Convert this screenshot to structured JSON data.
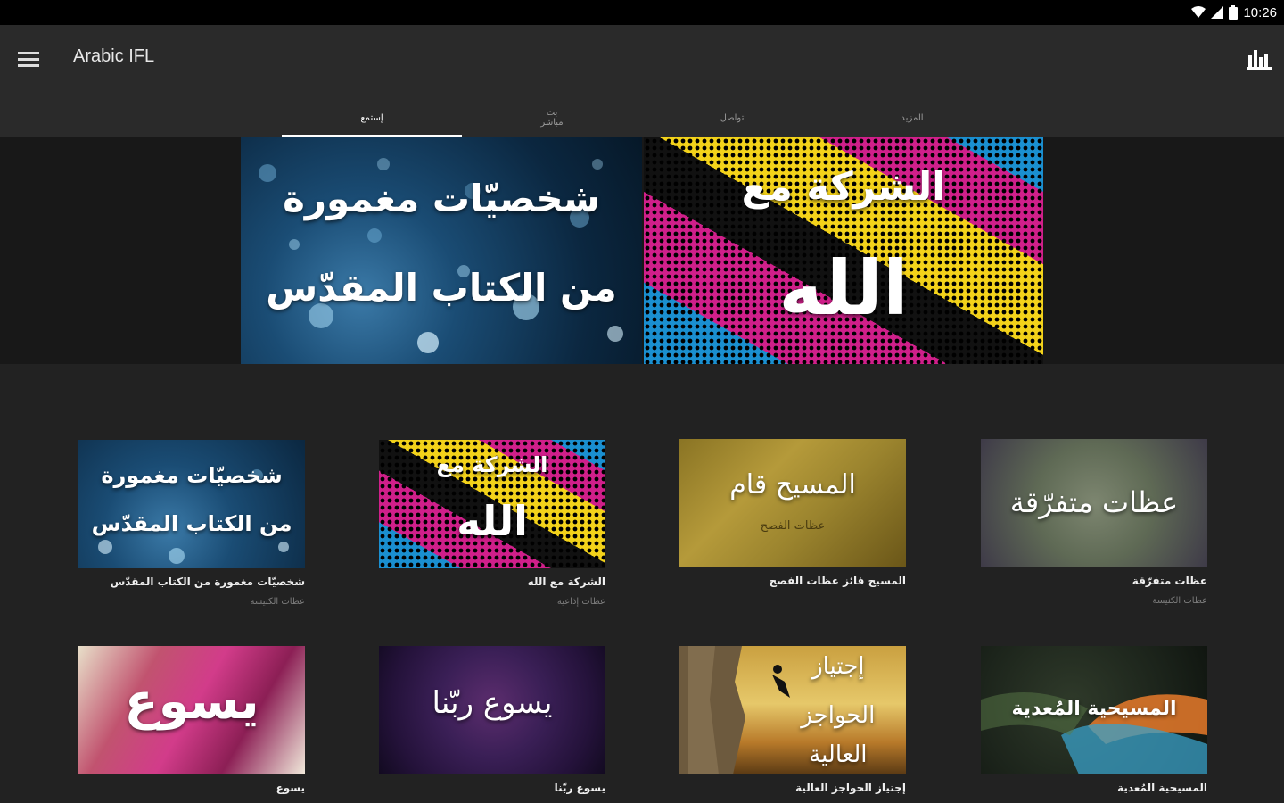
{
  "status": {
    "time": "10:26"
  },
  "app": {
    "title": "Arabic IFL"
  },
  "tabs": [
    {
      "label": "إستمع",
      "active": true
    },
    {
      "label": "بث\nمباشر",
      "active": false
    },
    {
      "label": "تواصل",
      "active": false
    },
    {
      "label": "المزيد",
      "active": false
    }
  ],
  "hero": [
    {
      "line1": "شخصيّات مغمورة",
      "line2": "من الكتاب المقدّس"
    },
    {
      "line1": "الشركة مع",
      "line2": "الله"
    }
  ],
  "cards": [
    {
      "art_line1": "شخصيّات مغمورة",
      "art_line2": "من الكتاب المقدّس",
      "title": "شخصيّات مغمورة من الكتاب المقدّس",
      "subtitle": "عظات الكنيسة"
    },
    {
      "art_line1": "الشركة مع",
      "art_line2": "الله",
      "title": "الشركة مع الله",
      "subtitle": "عظات إذاعية"
    },
    {
      "art_line1": "المسيح قام",
      "art_line2": "عظات الفصح",
      "title": "المسيح فائز عظات الفصح",
      "subtitle": ""
    },
    {
      "art_line1": "عظات متفرّقة",
      "art_line2": "",
      "title": "عظات متفرّقة",
      "subtitle": "عظات الكنيسة"
    },
    {
      "art_line1": "يسوع",
      "art_line2": "",
      "title": "يسوع",
      "subtitle": ""
    },
    {
      "art_line1": "يسوع ربّنا",
      "art_line2": "",
      "title": "يسوع ربّنا",
      "subtitle": ""
    },
    {
      "art_line1": "إجتياز",
      "art_line2": "الحواجز العالية",
      "title": "إجتياز الحواجز العالية",
      "subtitle": ""
    },
    {
      "art_line1": "المسيحية المُعدية",
      "art_line2": "",
      "title": "المسيحية المُعدية",
      "subtitle": ""
    }
  ],
  "colors": {
    "background": "#222222",
    "appbar": "#2a2a2a",
    "statusbar": "#000000",
    "tab_indicator": "#ffffff"
  },
  "icons": {
    "menu": "hamburger-icon",
    "stats": "bar-chart-icon",
    "wifi": "wifi-icon",
    "signal": "signal-icon",
    "battery": "battery-icon"
  }
}
